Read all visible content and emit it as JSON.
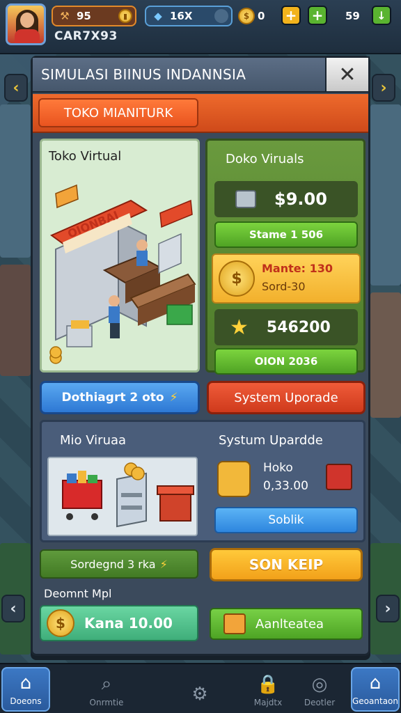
{
  "topbar": {
    "currency1_value": "95",
    "currency2_value": "16X",
    "currency3_value": "0",
    "currency4_value": "59",
    "player_id": "CAR7X93"
  },
  "panel": {
    "title": "SIMULASI BIINUS INDANNSIA",
    "close_glyph": "✕",
    "tab_label": "TOKO MIANITURK"
  },
  "store_card": {
    "label": "Toko Virtual",
    "sign_text": "OIONBAI"
  },
  "right_card": {
    "title": "Doko Viruals",
    "price1": "$9.00",
    "button1": "Stame 1 506",
    "coin_line1": "Mante: 130",
    "coin_line2": "Sord-30",
    "price2": "546200",
    "button2": "OION 2036"
  },
  "actions": {
    "blue_button": "Dothiagrt 2 oto",
    "red_button": "System Uporade"
  },
  "lower_section": {
    "left_title": "Mio Viruaa",
    "right_title": "Systum Upardde",
    "item_name": "Hoko",
    "item_price": "0,33.00",
    "item_button": "Soblik"
  },
  "bottom_rows": {
    "green_button": "Sordegnd 3 rka",
    "orange_button": "SON KEIP",
    "label_strip": "Deomnt Mpl",
    "money_button": "Kana 10.00",
    "gift_button": "Aanlteatea"
  },
  "nav": {
    "items": [
      {
        "label": "Doeons",
        "icon": "home-icon"
      },
      {
        "label": "Onrmtie",
        "icon": "search-icon"
      },
      {
        "label": "",
        "icon": "gear-icon"
      },
      {
        "label": "Majdtx",
        "icon": "lock-icon"
      },
      {
        "label": "Deotler",
        "icon": "target-icon"
      },
      {
        "label": "Geoantaon",
        "icon": "map-icon"
      }
    ]
  },
  "colors": {
    "accent_orange": "#e9541f",
    "accent_green": "#4fa324",
    "accent_blue": "#2d78d4",
    "panel_bg": "#3b4a5c"
  }
}
